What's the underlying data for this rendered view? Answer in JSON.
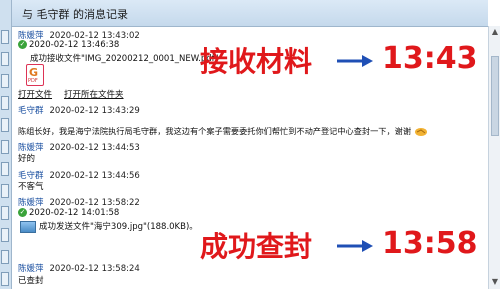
{
  "header": {
    "title": "与  毛守群  的消息记录"
  },
  "messages": [
    {
      "sender": "陈媛萍",
      "time": "2020-02-12 13:43:02"
    },
    {
      "status_time": "2020-02-12 13:46:38",
      "text": "成功接收文件\"IMG_20200212_0001_NEW.pdf\"",
      "file_icon_letter": "G",
      "file_ext": "PDF",
      "links": [
        "打开文件",
        "打开所在文件夹"
      ]
    },
    {
      "sender": "毛守群",
      "time": "2020-02-12 13:43:29",
      "text": "陈组长好，我是海宁法院执行局毛守群，我这边有个案子需要委托你们帮忙到不动产登记中心查封一下，谢谢"
    },
    {
      "sender": "陈媛萍",
      "time": "2020-02-12 13:44:53",
      "text": "好的"
    },
    {
      "sender": "毛守群",
      "time": "2020-02-12 13:44:56",
      "text": "不客气"
    },
    {
      "sender": "陈媛萍",
      "time": "2020-02-12 13:58:22"
    },
    {
      "status_time": "2020-02-12 14:01:58",
      "text": "成功发送文件\"海宁309.jpg\"(188.0KB)。"
    },
    {
      "sender": "陈媛萍",
      "time": "2020-02-12 13:58:24",
      "text": "已查封"
    }
  ],
  "annotations": {
    "top_label": "接收材料",
    "top_time": "13:43",
    "bottom_label": "成功查封",
    "bottom_time": "13:58",
    "color": "#e0181b",
    "arrow_color": "#1f4fb5"
  }
}
